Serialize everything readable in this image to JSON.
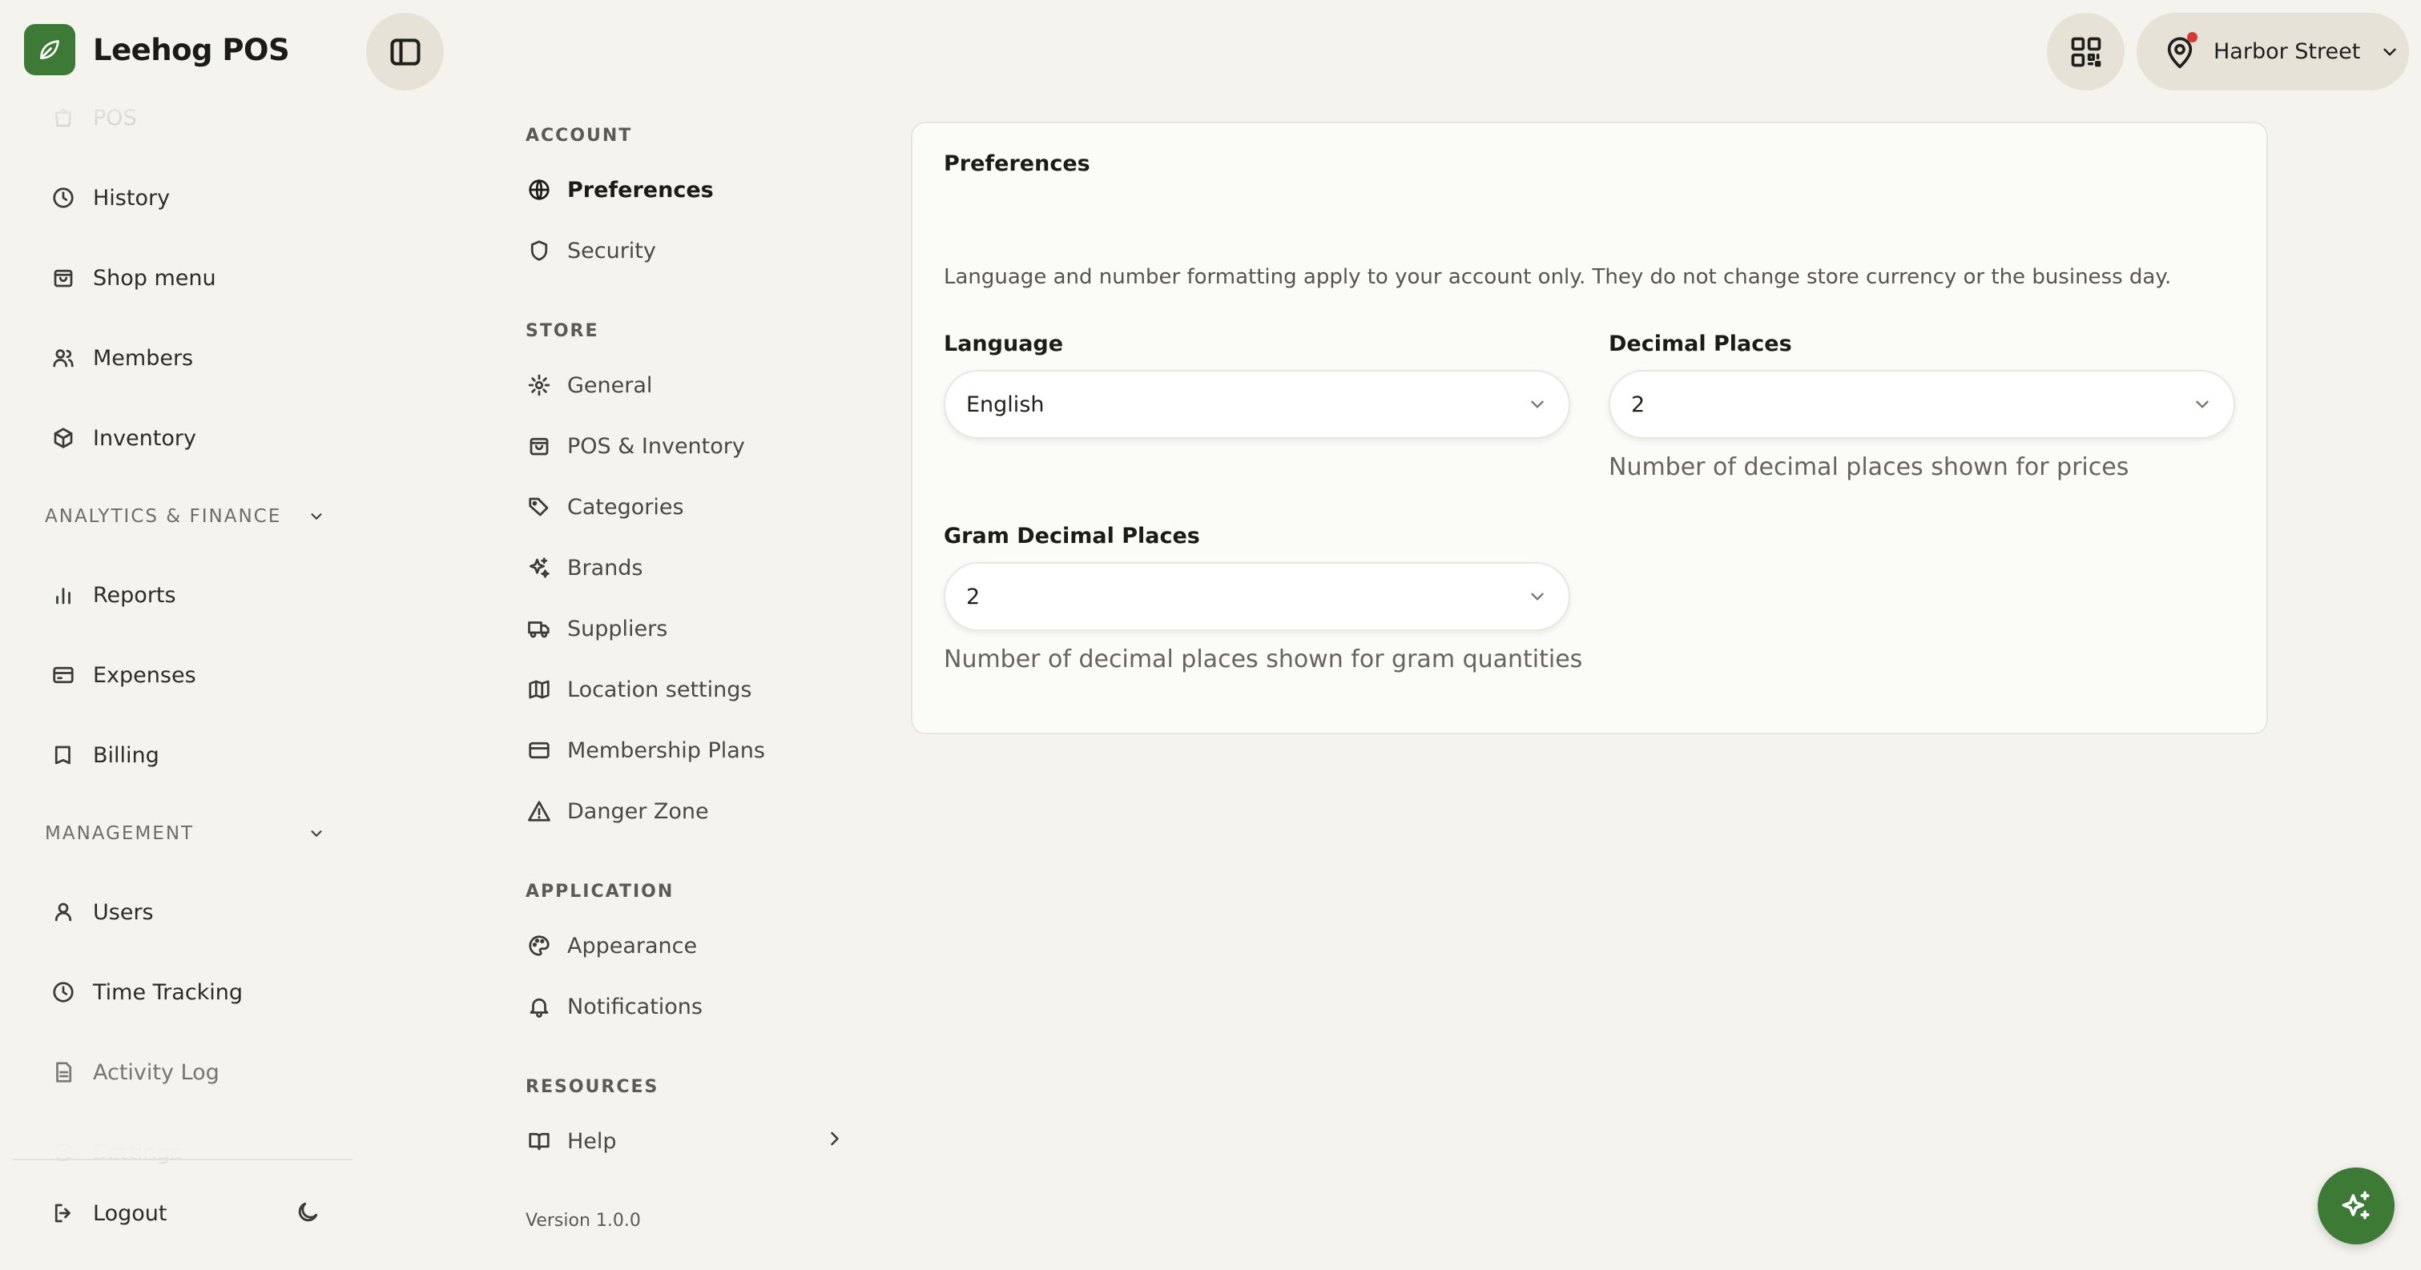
{
  "app": {
    "name": "Leehog POS"
  },
  "sidebar": {
    "items": [
      {
        "label": "POS"
      },
      {
        "label": "History"
      },
      {
        "label": "Shop menu"
      },
      {
        "label": "Members"
      },
      {
        "label": "Inventory"
      }
    ],
    "sections": [
      {
        "label": "ANALYTICS & FINANCE",
        "items": [
          {
            "label": "Reports"
          },
          {
            "label": "Expenses"
          },
          {
            "label": "Billing"
          }
        ]
      },
      {
        "label": "MANAGEMENT",
        "items": [
          {
            "label": "Users"
          },
          {
            "label": "Time Tracking"
          },
          {
            "label": "Activity Log"
          },
          {
            "label": "Settings"
          }
        ]
      }
    ],
    "logout_label": "Logout"
  },
  "settings_nav": {
    "account_label": "ACCOUNT",
    "account": [
      {
        "label": "Preferences"
      },
      {
        "label": "Security"
      }
    ],
    "store_label": "STORE",
    "store": [
      {
        "label": "General"
      },
      {
        "label": "POS & Inventory"
      },
      {
        "label": "Categories"
      },
      {
        "label": "Brands"
      },
      {
        "label": "Suppliers"
      },
      {
        "label": "Location settings"
      },
      {
        "label": "Membership Plans"
      },
      {
        "label": "Danger Zone"
      }
    ],
    "application_label": "APPLICATION",
    "application": [
      {
        "label": "Appearance"
      },
      {
        "label": "Notifications"
      }
    ],
    "resources_label": "RESOURCES",
    "resources": [
      {
        "label": "Help"
      }
    ],
    "version": "Version 1.0.0"
  },
  "header": {
    "location": "Harbor Street"
  },
  "preferences": {
    "title": "Preferences",
    "description": "Language and number formatting apply to your account only. They do not change store currency or the business day.",
    "language": {
      "label": "Language",
      "value": "English"
    },
    "decimal_places": {
      "label": "Decimal Places",
      "value": "2",
      "helper": "Number of decimal places shown for prices"
    },
    "gram_decimal_places": {
      "label": "Gram Decimal Places",
      "value": "2",
      "helper": "Number of decimal places shown for gram quantities"
    }
  },
  "colors": {
    "brand": "#3d7a36",
    "background": "#f4f3ee",
    "card": "#fbfbf8",
    "notification_dot": "#d43c32"
  }
}
